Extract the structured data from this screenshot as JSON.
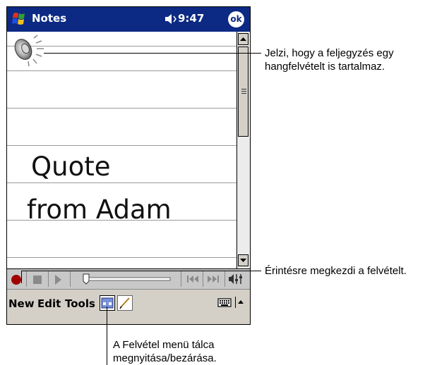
{
  "title_bar": {
    "app_title": "Notes",
    "time": "9:47",
    "ok_label": "ok",
    "icons": [
      "windows-flag-icon",
      "volume-icon"
    ]
  },
  "note": {
    "icons": [
      "speaker-icon"
    ],
    "lines": [
      "Quote",
      "from Adam"
    ]
  },
  "recording_toolbar": {
    "buttons": [
      "record",
      "stop",
      "play",
      "volume-slider",
      "skip-back",
      "skip-forward",
      "speaker-volume"
    ],
    "record_color": "#a00000",
    "volume_level": 0.0
  },
  "menu_bar": {
    "new_label": "New",
    "edit_label": "Edit",
    "tools_label": "Tools",
    "icons": [
      "recording-toolbar-icon",
      "pen-icon",
      "keyboard-icon",
      "arrow-up-icon"
    ]
  },
  "callouts": {
    "voice_note_indicator": "Jelzi, hogy a feljegyzés egy hangfelvételt is tartalmaz.",
    "record_button": "Érintésre megkezdi a felvételt.",
    "recording_toolbar_toggle": "A Felvétel menü tálca megnyitása/bezárása."
  },
  "colors": {
    "title_bar": "#0c2a84",
    "menu_bar": "#d4d0c8",
    "toolbar": "#c8c8c8"
  }
}
